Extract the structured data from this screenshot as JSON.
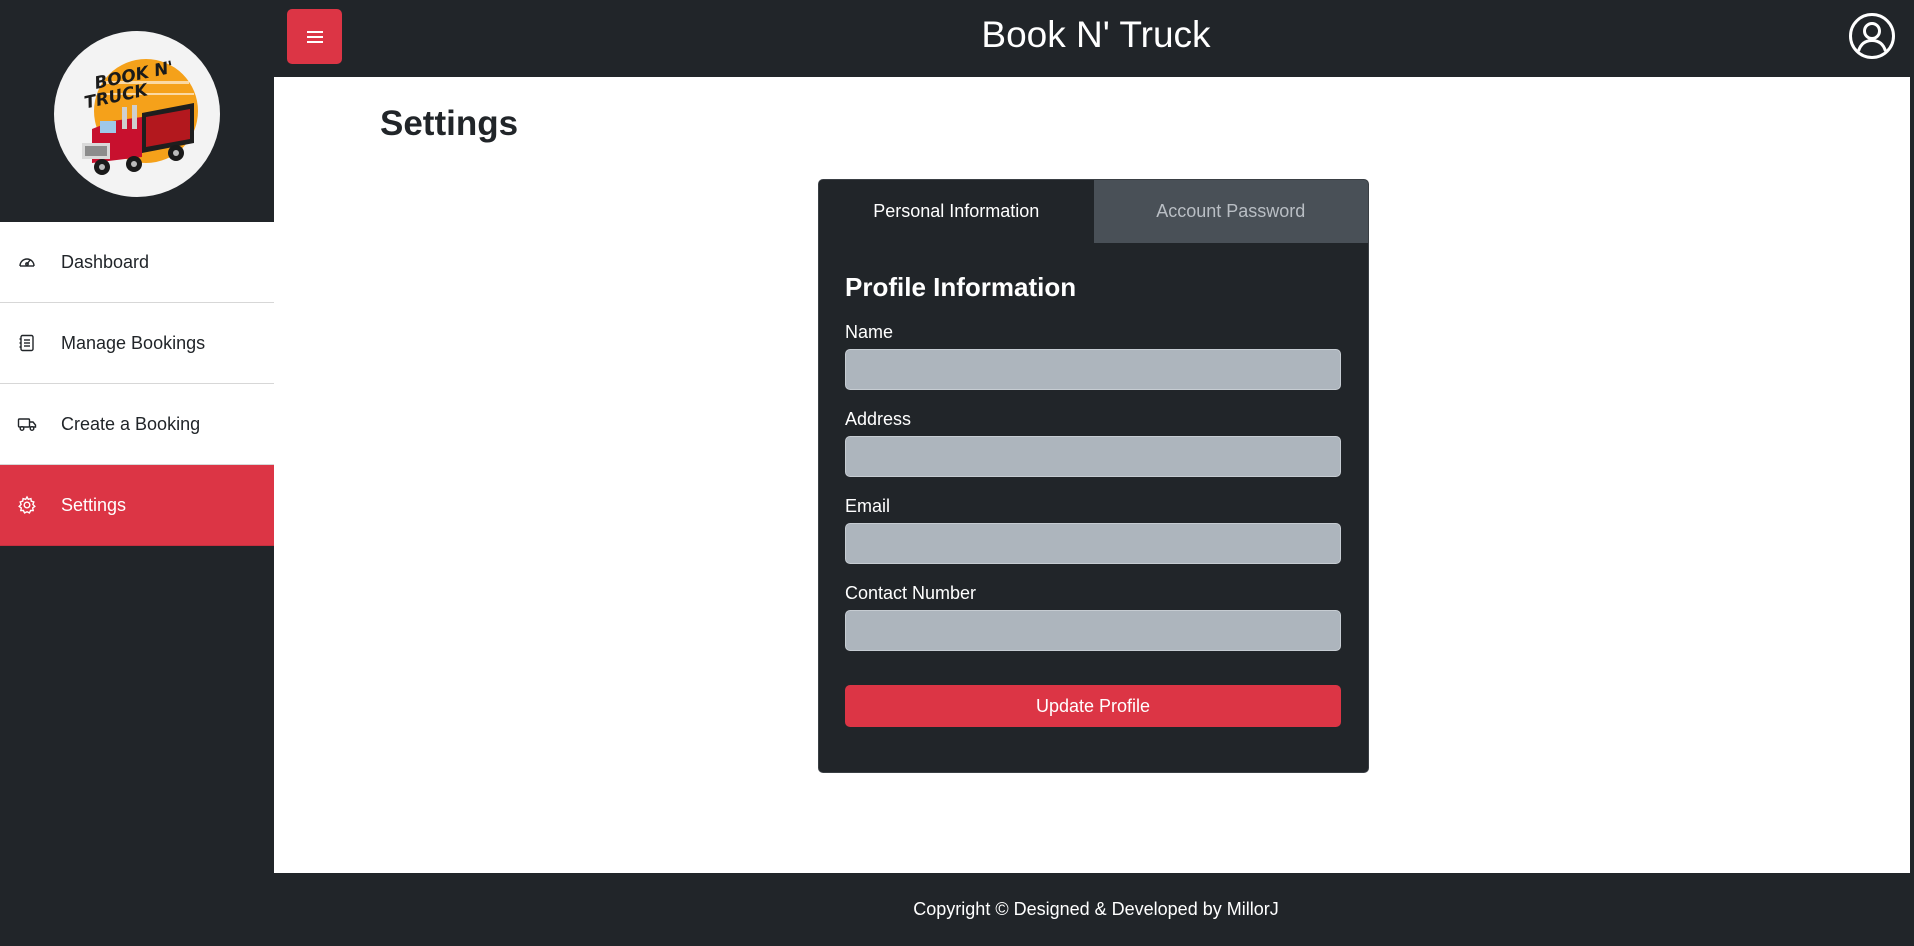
{
  "app": {
    "title": "Book N' Truck"
  },
  "logo": {
    "line1": "BOOK N'",
    "line2": "TRUCK"
  },
  "sidebar": {
    "items": [
      {
        "label": "Dashboard",
        "icon": "gauge-icon",
        "active": false
      },
      {
        "label": "Manage Bookings",
        "icon": "list-document-icon",
        "active": false
      },
      {
        "label": "Create a Booking",
        "icon": "truck-icon",
        "active": false
      },
      {
        "label": "Settings",
        "icon": "gear-icon",
        "active": true
      }
    ]
  },
  "header": {
    "menu_icon": "hamburger-menu-icon",
    "user_icon": "user-circle-icon"
  },
  "main": {
    "page_title": "Settings",
    "tabs": [
      {
        "label": "Personal Information",
        "active": true
      },
      {
        "label": "Account Password",
        "active": false
      }
    ],
    "form": {
      "title": "Profile Information",
      "fields": [
        {
          "label": "Name",
          "value": "",
          "placeholder": ""
        },
        {
          "label": "Address",
          "value": "",
          "placeholder": ""
        },
        {
          "label": "Email",
          "value": "",
          "placeholder": ""
        },
        {
          "label": "Contact Number",
          "value": "",
          "placeholder": ""
        }
      ],
      "submit_label": "Update Profile"
    }
  },
  "footer": {
    "text": "Copyright © Designed & Developed by MillorJ"
  },
  "colors": {
    "accent": "#dc3545",
    "dark": "#212529",
    "input_bg": "#adb5bd",
    "inactive_tab": "#495057"
  }
}
